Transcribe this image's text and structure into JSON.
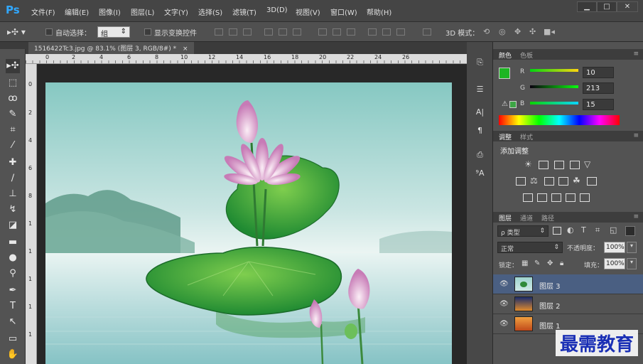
{
  "app": {
    "logo": "Ps"
  },
  "menu": [
    "文件(F)",
    "编辑(E)",
    "图像(I)",
    "图层(L)",
    "文字(Y)",
    "选择(S)",
    "滤镜(T)",
    "3D(D)",
    "视图(V)",
    "窗口(W)",
    "帮助(H)"
  ],
  "window_buttons": {
    "minimize": "▁",
    "maximize": "□",
    "close": "✕"
  },
  "options": {
    "auto_select_label": "自动选择：",
    "auto_select_value": "组",
    "transform_label": "显示变换控件",
    "mode_3d_label": "3D 模式："
  },
  "document": {
    "tab_title": "1516422Tc3.jpg @ 83.1% (图层 3, RGB/8#) *",
    "close": "×"
  },
  "ruler_top": [
    "0",
    "2",
    "4",
    "6",
    "8",
    "10",
    "12",
    "14",
    "16",
    "18",
    "20",
    "22",
    "24",
    "26"
  ],
  "ruler_left": [
    "0",
    "2",
    "4",
    "6",
    "8",
    "1",
    "1",
    "1",
    "1",
    "1"
  ],
  "color_panel": {
    "tabs": [
      "颜色",
      "色板"
    ],
    "foreground": "#1db623",
    "r_label": "R",
    "r_value": "10",
    "g_label": "G",
    "g_value": "213",
    "b_label": "B",
    "b_value": "15"
  },
  "adjust_panel": {
    "tabs": [
      "调整",
      "样式"
    ],
    "title": "添加调整"
  },
  "layers_panel": {
    "tabs": [
      "图层",
      "通道",
      "路径"
    ],
    "filter_label": "ρ 类型",
    "blend_mode": "正常",
    "opacity_label": "不透明度：",
    "opacity_value": "100%",
    "lock_label": "锁定：",
    "fill_label": "填充：",
    "fill_value": "100%",
    "layers": [
      {
        "name": "图层 3",
        "selected": true
      },
      {
        "name": "图层 2",
        "selected": false
      },
      {
        "name": "图层 1",
        "selected": false
      }
    ]
  },
  "watermark": "最需教育"
}
